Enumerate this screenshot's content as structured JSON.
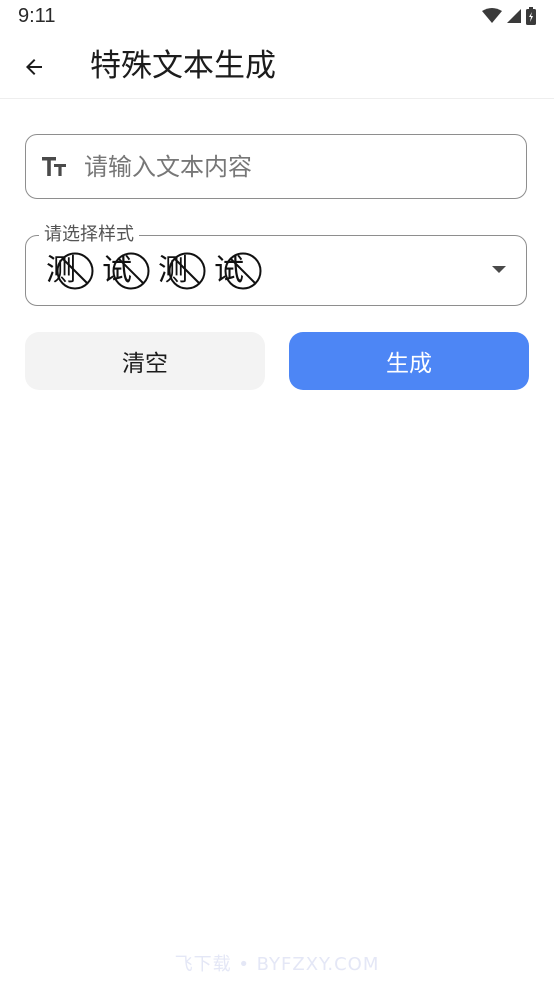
{
  "status_bar": {
    "time": "9:11",
    "icons": [
      "wifi-icon",
      "signal-icon",
      "battery-icon"
    ]
  },
  "app_bar": {
    "title": "特殊文本生成",
    "back_icon": "arrow-left-icon"
  },
  "text_input": {
    "placeholder": "请输入文本内容",
    "value": "",
    "icon": "text-size-icon"
  },
  "style_select": {
    "label": "请选择样式",
    "selected_chars": [
      "测",
      "试",
      "测",
      "试"
    ],
    "icon": "chevron-down-icon"
  },
  "buttons": {
    "clear_label": "清空",
    "generate_label": "生成"
  },
  "watermark": "飞下载 • BYFZXY.COM",
  "colors": {
    "primary": "#4d86f5",
    "secondary_button": "#f3f3f3",
    "border": "#8e8e8e"
  }
}
